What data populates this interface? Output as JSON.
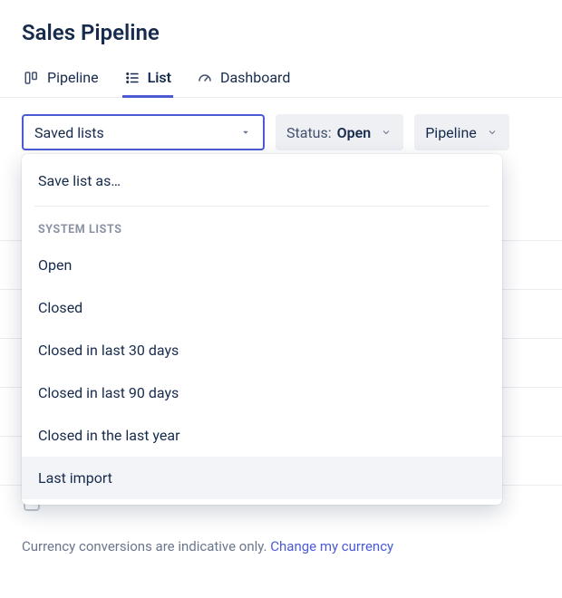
{
  "title": "Sales Pipeline",
  "tabs": {
    "pipeline": "Pipeline",
    "list": "List",
    "dashboard": "Dashboard"
  },
  "saved_lists": {
    "button_label": "Saved lists",
    "save_as": "Save list as…",
    "section_header": "SYSTEM LISTS",
    "items": [
      "Open",
      "Closed",
      "Closed in last 30 days",
      "Closed in last 90 days",
      "Closed in the last year",
      "Last import"
    ]
  },
  "filters": {
    "status_label": "Status:",
    "status_value": "Open",
    "pipeline_label": "Pipeline"
  },
  "footer": {
    "text": "Currency conversions are indicative only. ",
    "link": "Change my currency"
  }
}
